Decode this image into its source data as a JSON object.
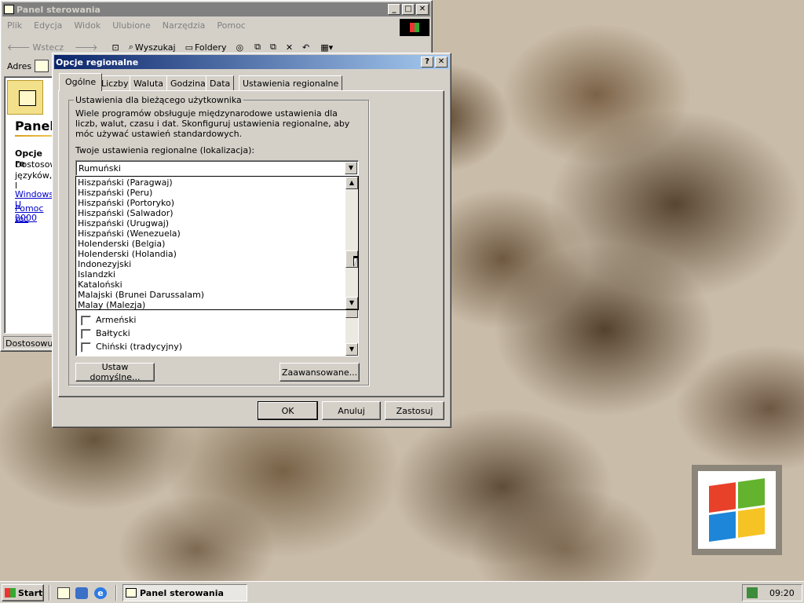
{
  "explorer": {
    "title": "Panel sterowania",
    "menu": [
      "Plik",
      "Edycja",
      "Widok",
      "Ulubione",
      "Narzędzia",
      "Pomoc"
    ],
    "toolbar": {
      "back": "Wstecz",
      "search": "Wyszukaj",
      "folders": "Foldery"
    },
    "address_label": "Adres",
    "heading": "Panel",
    "section_title": "Opcje re",
    "section_text1": "Dostosow",
    "section_text2": "języków, l",
    "link1": "Windows U",
    "link2a": "Pomoc tec",
    "link2b": "2000",
    "status": "Dostosowuje"
  },
  "dialog": {
    "title": "Opcje regionalne",
    "help": "?",
    "close": "✕",
    "tabs": [
      "Ogólne",
      "Liczby",
      "Waluta",
      "Godzina",
      "Data",
      "Ustawienia regionalne"
    ],
    "group_title": "Ustawienia dla bieżącego użytkownika",
    "description": "Wiele programów obsługuje międzynarodowe ustawienia dla liczb, walut, czasu i dat. Skonfiguruj ustawienia regionalne, aby móc używać ustawień standardowych.",
    "locale_label": "Twoje ustawienia regionalne (lokalizacja):",
    "locale_value": "Rumuński",
    "dropdown_items": [
      "Hiszpański (Paragwaj)",
      "Hiszpański (Peru)",
      "Hiszpański (Portoryko)",
      "Hiszpański (Salwador)",
      "Hiszpański (Urugwaj)",
      "Hiszpański (Wenezuela)",
      "Holenderski (Belgia)",
      "Holenderski (Holandia)",
      "Indonezyjski",
      "Islandzki",
      "Kataloński",
      "Malajski (Brunei Darussalam)",
      "Malay (Malezja)"
    ],
    "languages": [
      "Armeński",
      "Bałtycki",
      "Chiński (tradycyjny)"
    ],
    "set_default": "Ustaw domyślne...",
    "advanced": "Zaawansowane...",
    "ok": "OK",
    "cancel": "Anuluj",
    "apply": "Zastosuj"
  },
  "taskbar": {
    "start": "Start",
    "task": "Panel sterowania",
    "clock": "09:20"
  }
}
